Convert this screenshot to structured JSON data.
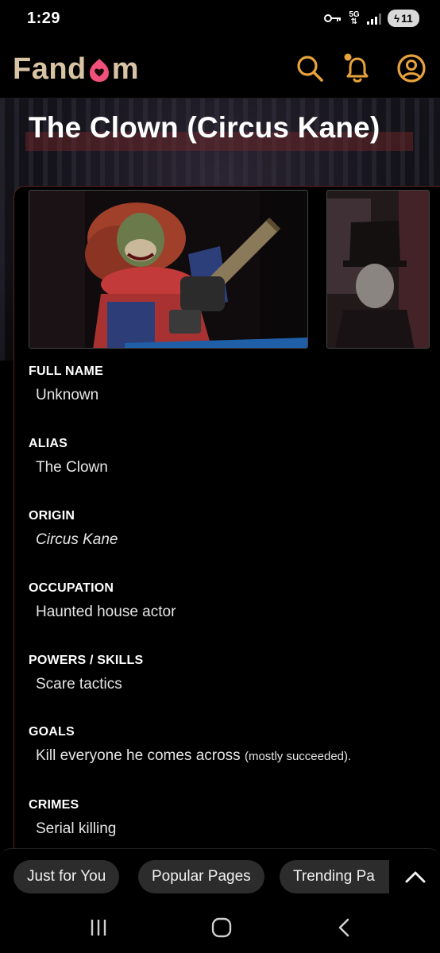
{
  "status_bar": {
    "time": "1:29",
    "network_badge": "5G",
    "battery": "11",
    "icons": [
      "vpn-key-icon",
      "5g-icon",
      "signal-icon",
      "battery-charging-icon"
    ]
  },
  "header": {
    "logo_text_left": "Fand",
    "logo_text_right": "m",
    "icons": [
      "search-icon",
      "bell-icon",
      "user-icon"
    ],
    "accent_color": "#e8a33d",
    "logo_color": "#d8c3a5",
    "heart_color": "#f0507a"
  },
  "page": {
    "title": "The Clown (Circus Kane)"
  },
  "infobox": {
    "fields": [
      {
        "label": "FULL NAME",
        "value": "Unknown"
      },
      {
        "label": "ALIAS",
        "value": "The Clown"
      },
      {
        "label": "ORIGIN",
        "value": "Circus Kane"
      },
      {
        "label": "OCCUPATION",
        "value": "Haunted house actor"
      },
      {
        "label": "POWERS / SKILLS",
        "value": "Scare tactics"
      },
      {
        "label": "GOALS",
        "value": "Kill everyone he comes across",
        "value_small": "(mostly succeeded)."
      },
      {
        "label": "CRIMES",
        "value": "Serial killing"
      }
    ]
  },
  "recommendations": {
    "pills": [
      "Just for You",
      "Popular Pages",
      "Trending Pa"
    ]
  },
  "nav": {
    "icons": [
      "recents-icon",
      "home-icon",
      "back-icon"
    ]
  }
}
